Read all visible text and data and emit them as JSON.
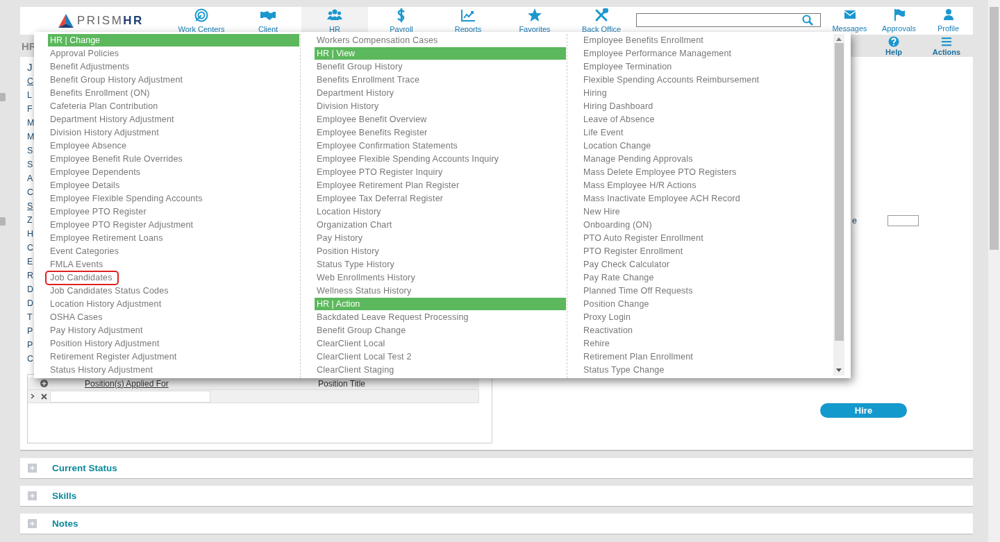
{
  "nav": {
    "logo": {
      "name": "PRISM",
      "accent": "HR"
    },
    "items": [
      {
        "label": "Work Centers",
        "selected": false
      },
      {
        "label": "Client",
        "selected": false
      },
      {
        "label": "HR",
        "selected": true
      },
      {
        "label": "Payroll",
        "selected": false
      },
      {
        "label": "Reports",
        "selected": false
      },
      {
        "label": "Favorites",
        "selected": false
      },
      {
        "label": "Back Office",
        "selected": false
      }
    ],
    "user_items": [
      {
        "label": "Messages"
      },
      {
        "label": "Approvals"
      },
      {
        "label": "Profile"
      }
    ]
  },
  "toolbar": {
    "title": "HR",
    "tools": [
      {
        "label": "Help"
      },
      {
        "label": "Actions"
      }
    ]
  },
  "form": {
    "labels": [
      {
        "text": "J",
        "kind": "heading"
      },
      {
        "text": "C",
        "kind": "link"
      },
      {
        "text": "L",
        "kind": "label"
      },
      {
        "text": "F",
        "kind": "label"
      },
      {
        "text": "M",
        "kind": "label"
      },
      {
        "text": "M",
        "kind": "label"
      },
      {
        "text": "S",
        "kind": "label"
      },
      {
        "text": "S",
        "kind": "label"
      },
      {
        "text": "A",
        "kind": "label"
      },
      {
        "text": "C",
        "kind": "label"
      },
      {
        "text": "S",
        "kind": "link"
      },
      {
        "text": "Z",
        "kind": "label"
      },
      {
        "text": "H",
        "kind": "label"
      },
      {
        "text": "C",
        "kind": "label"
      },
      {
        "text": "E",
        "kind": "label"
      },
      {
        "text": "R",
        "kind": "label"
      },
      {
        "text": "D",
        "kind": "label"
      },
      {
        "text": "D",
        "kind": "label"
      },
      {
        "text": "T",
        "kind": "label"
      },
      {
        "text": "P",
        "kind": "label"
      },
      {
        "text": "P",
        "kind": "label"
      },
      {
        "text": "C",
        "kind": "label"
      }
    ],
    "grid": {
      "columns": [
        {
          "label": "Position(s) Applied For",
          "kind": "link"
        },
        {
          "label": "Position Title",
          "kind": "plain"
        }
      ]
    },
    "right_label": "e",
    "hire_button": "Hire"
  },
  "sections": [
    {
      "title": "Current Status",
      "expanded": false
    },
    {
      "title": "Skills",
      "expanded": false
    },
    {
      "title": "Notes",
      "expanded": false
    }
  ],
  "menu": {
    "columns": [
      [
        {
          "kind": "header",
          "label": "HR | Change"
        },
        {
          "kind": "item",
          "label": "Approval Policies",
          "selected": false
        },
        {
          "kind": "item",
          "label": "Benefit Adjustments",
          "selected": false
        },
        {
          "kind": "item",
          "label": "Benefit Group History Adjustment",
          "selected": false
        },
        {
          "kind": "item",
          "label": "Benefits Enrollment (ON)",
          "selected": false
        },
        {
          "kind": "item",
          "label": "Cafeteria Plan Contribution",
          "selected": false
        },
        {
          "kind": "item",
          "label": "Department History Adjustment",
          "selected": false
        },
        {
          "kind": "item",
          "label": "Division History Adjustment",
          "selected": false
        },
        {
          "kind": "item",
          "label": "Employee Absence",
          "selected": false
        },
        {
          "kind": "item",
          "label": "Employee Benefit Rule Overrides",
          "selected": false
        },
        {
          "kind": "item",
          "label": "Employee Dependents",
          "selected": false
        },
        {
          "kind": "item",
          "label": "Employee Details",
          "selected": false
        },
        {
          "kind": "item",
          "label": "Employee Flexible Spending Accounts",
          "selected": false
        },
        {
          "kind": "item",
          "label": "Employee PTO Register",
          "selected": false
        },
        {
          "kind": "item",
          "label": "Employee PTO Register Adjustment",
          "selected": false
        },
        {
          "kind": "item",
          "label": "Employee Retirement Loans",
          "selected": false
        },
        {
          "kind": "item",
          "label": "Event Categories",
          "selected": false
        },
        {
          "kind": "item",
          "label": "FMLA Events",
          "selected": false
        },
        {
          "kind": "item",
          "label": "Job Candidates",
          "selected": true
        },
        {
          "kind": "item",
          "label": "Job Candidates Status Codes",
          "selected": false
        },
        {
          "kind": "item",
          "label": "Location History Adjustment",
          "selected": false
        },
        {
          "kind": "item",
          "label": "OSHA Cases",
          "selected": false
        },
        {
          "kind": "item",
          "label": "Pay History Adjustment",
          "selected": false
        },
        {
          "kind": "item",
          "label": "Position History Adjustment",
          "selected": false
        },
        {
          "kind": "item",
          "label": "Retirement Register Adjustment",
          "selected": false
        },
        {
          "kind": "item",
          "label": "Status History Adjustment",
          "selected": false
        }
      ],
      [
        {
          "kind": "item",
          "label": "Workers Compensation Cases",
          "selected": false
        },
        {
          "kind": "header",
          "label": "HR | View"
        },
        {
          "kind": "item",
          "label": "Benefit Group History",
          "selected": false
        },
        {
          "kind": "item",
          "label": "Benefits Enrollment Trace",
          "selected": false
        },
        {
          "kind": "item",
          "label": "Department History",
          "selected": false
        },
        {
          "kind": "item",
          "label": "Division History",
          "selected": false
        },
        {
          "kind": "item",
          "label": "Employee Benefit Overview",
          "selected": false
        },
        {
          "kind": "item",
          "label": "Employee Benefits Register",
          "selected": false
        },
        {
          "kind": "item",
          "label": "Employee Confirmation Statements",
          "selected": false
        },
        {
          "kind": "item",
          "label": "Employee Flexible Spending Accounts Inquiry",
          "selected": false
        },
        {
          "kind": "item",
          "label": "Employee PTO Register Inquiry",
          "selected": false
        },
        {
          "kind": "item",
          "label": "Employee Retirement Plan Register",
          "selected": false
        },
        {
          "kind": "item",
          "label": "Employee Tax Deferral Register",
          "selected": false
        },
        {
          "kind": "item",
          "label": "Location History",
          "selected": false
        },
        {
          "kind": "item",
          "label": "Organization Chart",
          "selected": false
        },
        {
          "kind": "item",
          "label": "Pay History",
          "selected": false
        },
        {
          "kind": "item",
          "label": "Position History",
          "selected": false
        },
        {
          "kind": "item",
          "label": "Status Type History",
          "selected": false
        },
        {
          "kind": "item",
          "label": "Web Enrollments History",
          "selected": false
        },
        {
          "kind": "item",
          "label": "Wellness Status History",
          "selected": false
        },
        {
          "kind": "header",
          "label": "HR | Action"
        },
        {
          "kind": "item",
          "label": "Backdated Leave Request Processing",
          "selected": false
        },
        {
          "kind": "item",
          "label": "Benefit Group Change",
          "selected": false
        },
        {
          "kind": "item",
          "label": "ClearClient Local",
          "selected": false
        },
        {
          "kind": "item",
          "label": "ClearClient Local Test 2",
          "selected": false
        },
        {
          "kind": "item",
          "label": "ClearClient Staging",
          "selected": false
        }
      ],
      [
        {
          "kind": "item",
          "label": "Employee Benefits Enrollment",
          "selected": false
        },
        {
          "kind": "item",
          "label": "Employee Performance Management",
          "selected": false
        },
        {
          "kind": "item",
          "label": "Employee Termination",
          "selected": false
        },
        {
          "kind": "item",
          "label": "Flexible Spending Accounts Reimbursement",
          "selected": false
        },
        {
          "kind": "item",
          "label": "Hiring",
          "selected": false
        },
        {
          "kind": "item",
          "label": "Hiring Dashboard",
          "selected": false
        },
        {
          "kind": "item",
          "label": "Leave of Absence",
          "selected": false
        },
        {
          "kind": "item",
          "label": "Life Event",
          "selected": false
        },
        {
          "kind": "item",
          "label": "Location Change",
          "selected": false
        },
        {
          "kind": "item",
          "label": "Manage Pending Approvals",
          "selected": false
        },
        {
          "kind": "item",
          "label": "Mass Delete Employee PTO Registers",
          "selected": false
        },
        {
          "kind": "item",
          "label": "Mass Employee H/R Actions",
          "selected": false
        },
        {
          "kind": "item",
          "label": "Mass Inactivate Employee ACH Record",
          "selected": false
        },
        {
          "kind": "item",
          "label": "New Hire",
          "selected": false
        },
        {
          "kind": "item",
          "label": "Onboarding (ON)",
          "selected": false
        },
        {
          "kind": "item",
          "label": "PTO Auto Register Enrollment",
          "selected": false
        },
        {
          "kind": "item",
          "label": "PTO Register Enrollment",
          "selected": false
        },
        {
          "kind": "item",
          "label": "Pay Check Calculator",
          "selected": false
        },
        {
          "kind": "item",
          "label": "Pay Rate Change",
          "selected": false
        },
        {
          "kind": "item",
          "label": "Planned Time Off Requests",
          "selected": false
        },
        {
          "kind": "item",
          "label": "Position Change",
          "selected": false
        },
        {
          "kind": "item",
          "label": "Proxy Login",
          "selected": false
        },
        {
          "kind": "item",
          "label": "Reactivation",
          "selected": false
        },
        {
          "kind": "item",
          "label": "Rehire",
          "selected": false
        },
        {
          "kind": "item",
          "label": "Retirement Plan Enrollment",
          "selected": false
        },
        {
          "kind": "item",
          "label": "Status Type Change",
          "selected": false
        }
      ]
    ]
  }
}
